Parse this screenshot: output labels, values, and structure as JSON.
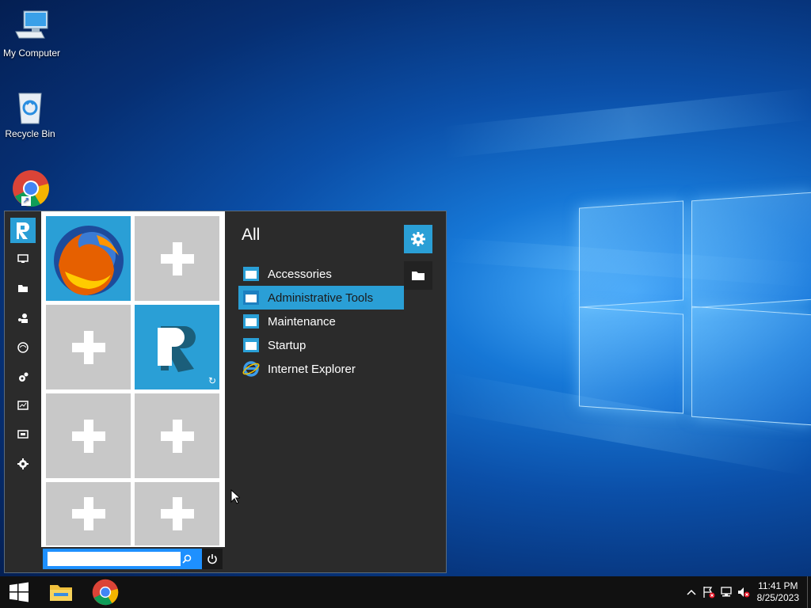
{
  "desktop": {
    "icons": [
      {
        "label": "My Computer",
        "icon": "computer-icon"
      },
      {
        "label": "Recycle Bin",
        "icon": "recycle-bin-icon"
      },
      {
        "label": "",
        "icon": "chrome-icon"
      }
    ]
  },
  "start_menu": {
    "rail": [
      "monitor-icon",
      "folder-icon",
      "user-icon",
      "globe-icon",
      "settings-icon",
      "chart-icon",
      "display-icon",
      "gear-icon"
    ],
    "tiles": [
      {
        "type": "firefox",
        "icon": "firefox-icon"
      },
      {
        "type": "add",
        "icon": "plus-icon"
      },
      {
        "type": "add",
        "icon": "plus-icon"
      },
      {
        "type": "app",
        "icon": "r-app-icon"
      },
      {
        "type": "add",
        "icon": "plus-icon"
      },
      {
        "type": "add",
        "icon": "plus-icon"
      },
      {
        "type": "add",
        "icon": "plus-icon"
      },
      {
        "type": "add",
        "icon": "plus-icon"
      }
    ],
    "search": {
      "value": "",
      "placeholder": ""
    },
    "list": {
      "title": "All",
      "items": [
        {
          "label": "Accessories",
          "icon": "folder-icon",
          "selected": false
        },
        {
          "label": "Administrative Tools",
          "icon": "folder-icon",
          "selected": true
        },
        {
          "label": "Maintenance",
          "icon": "folder-icon",
          "selected": false
        },
        {
          "label": "Startup",
          "icon": "folder-icon",
          "selected": false
        },
        {
          "label": "Internet Explorer",
          "icon": "ie-icon",
          "selected": false
        }
      ]
    }
  },
  "taskbar": {
    "clock_time": "11:41 PM",
    "clock_date": "8/25/2023"
  },
  "colors": {
    "accent": "#2a9fd6",
    "panel": "#2b2b2b",
    "taskbar": "#111111",
    "tile_empty": "#c8c8c8"
  }
}
